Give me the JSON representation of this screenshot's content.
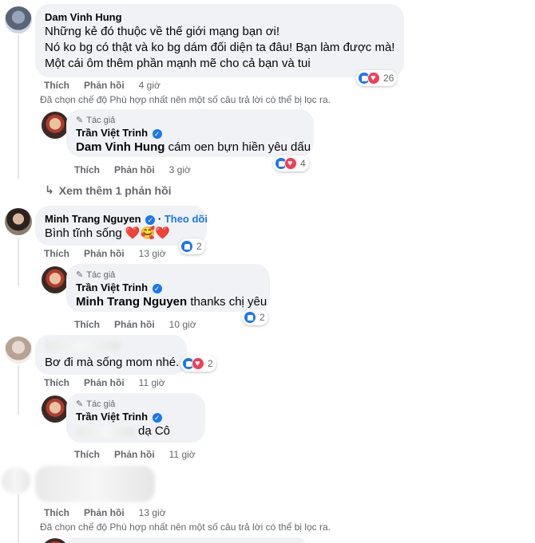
{
  "labels": {
    "like": "Thích",
    "reply": "Phản hồi",
    "author_tag": "Tác giả",
    "follow": "Theo dõi",
    "filter_notice": "Đã chọn chế độ Phù hợp nhất nên một số câu trả lời có thể bị lọc ra."
  },
  "colors": {
    "accent": "#1877f2",
    "bubble": "#f0f2f5",
    "muted": "#65676b",
    "love": "#f33e58"
  },
  "comments": [
    {
      "author": "Dam Vinh Hung",
      "lines": [
        "Những kẻ đó thuộc về thế giới mạng bạn ơi!",
        "Nó ko bg có thật và ko bg dám đối diện ta đâu! Bạn làm được mà!",
        "Một cái ôm thêm phần mạnh mẽ cho cả bạn và tui"
      ],
      "time": "4 giờ",
      "reaction_count": "26",
      "reply": {
        "author": "Trần Việt Trinh",
        "mention": "Dam Vinh Hung",
        "text": " cám oen bựn hiền yêu dấu",
        "time": "3 giờ",
        "reaction_count": "4"
      }
    },
    {
      "author": "Minh Trang Nguyen",
      "text": "Bình tĩnh sống ❤️🥰❤️",
      "time": "13 giờ",
      "reaction_count": "2",
      "reply": {
        "author": "Trần Việt Trinh",
        "mention": "Minh Trang Nguyen",
        "text": " thanks chị yêu",
        "time": "10 giờ",
        "reaction_count": "2"
      }
    },
    {
      "text": "Bơ đi mà sống mom nhé.",
      "time": "11 giờ",
      "reaction_count": "2",
      "reply": {
        "author": "Trần Việt Trinh",
        "text": " dạ Cô",
        "time": "11 giờ"
      }
    },
    {
      "time": "13 giờ"
    }
  ],
  "more_replies": "Xem thêm 1 phản hồi"
}
